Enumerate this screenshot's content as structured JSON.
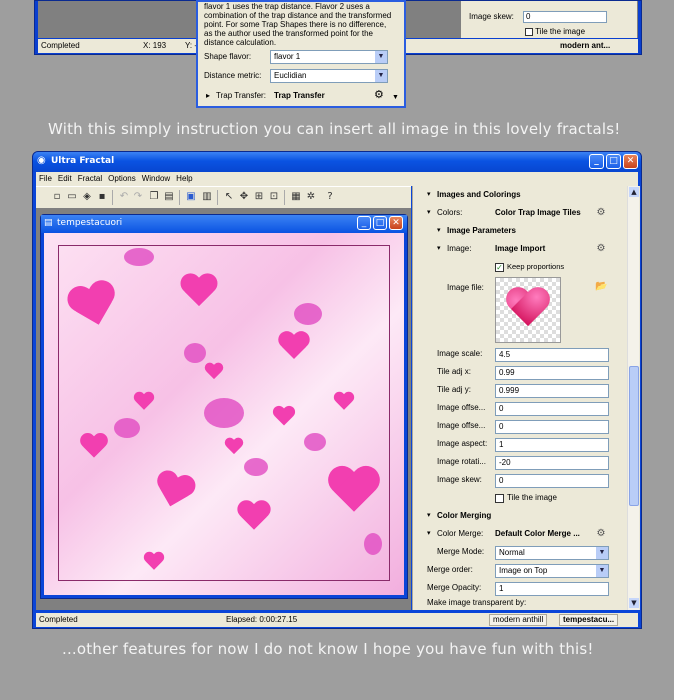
{
  "top_window": {
    "status_left": "Completed",
    "status_x": "X: 193",
    "status_y": "Y: -",
    "tab": "modern ant...",
    "right_panel": {
      "image_skew_label": "Image skew:",
      "image_skew_value": "0",
      "tile_label": "Tile the image"
    },
    "popup": {
      "desc_line1": "flavor 1 uses the trap distance. Flavor 2 uses a",
      "desc_line2": "combination of the trap distance and the transformed",
      "desc_line3": "point. For some Trap Shapes there is no difference,",
      "desc_line4": "as the author used the transformed point for the",
      "desc_line5": "distance calculation.",
      "shape_flavor_label": "Shape flavor:",
      "shape_flavor_value": "flavor 1",
      "distance_metric_label": "Distance metric:",
      "distance_metric_value": "Euclidian",
      "trap_transfer_label": "Trap Transfer:",
      "trap_transfer_value": "Trap Transfer"
    }
  },
  "caption_top": "With this simply instruction you can insert all image in this lovely fractals!",
  "caption_bottom": "...other features for now I do not know I hope you have fun with this!",
  "window": {
    "title": "Ultra Fractal",
    "menu": [
      "File",
      "Edit",
      "Fractal",
      "Options",
      "Window",
      "Help"
    ],
    "child_title": "tempestacuori",
    "status": {
      "left": "Completed",
      "elapsed": "Elapsed: 0:00:27.15",
      "tab1": "modern anthill",
      "tab2": "tempestacu..."
    }
  },
  "panel": {
    "images_colorings": "Images and Colorings",
    "colors_label": "Colors:",
    "colors_value": "Color Trap Image Tiles",
    "image_parameters": "Image Parameters",
    "image_label": "Image:",
    "image_value": "Image Import",
    "keep_proportions": "Keep proportions",
    "image_file_label": "Image file:",
    "params": [
      {
        "label": "Image scale:",
        "value": "4.5"
      },
      {
        "label": "Tile adj x:",
        "value": "0.99"
      },
      {
        "label": "Tile adj y:",
        "value": "0.999"
      },
      {
        "label": "Image offse...",
        "value": "0"
      },
      {
        "label": "Image offse...",
        "value": "0"
      },
      {
        "label": "Image aspect:",
        "value": "1"
      },
      {
        "label": "Image rotati...",
        "value": "-20"
      },
      {
        "label": "Image skew:",
        "value": "0"
      }
    ],
    "tile_image": "Tile the image",
    "color_merging": "Color Merging",
    "color_merge_label": "Color Merge:",
    "color_merge_value": "Default Color Merge ...",
    "merge_mode_label": "Merge Mode:",
    "merge_mode_value": "Normal",
    "merge_order_label": "Merge order:",
    "merge_order_value": "Image on Top",
    "merge_opacity_label": "Merge Opacity:",
    "merge_opacity_value": "1",
    "make_transparent": "Make image transparent by:"
  }
}
